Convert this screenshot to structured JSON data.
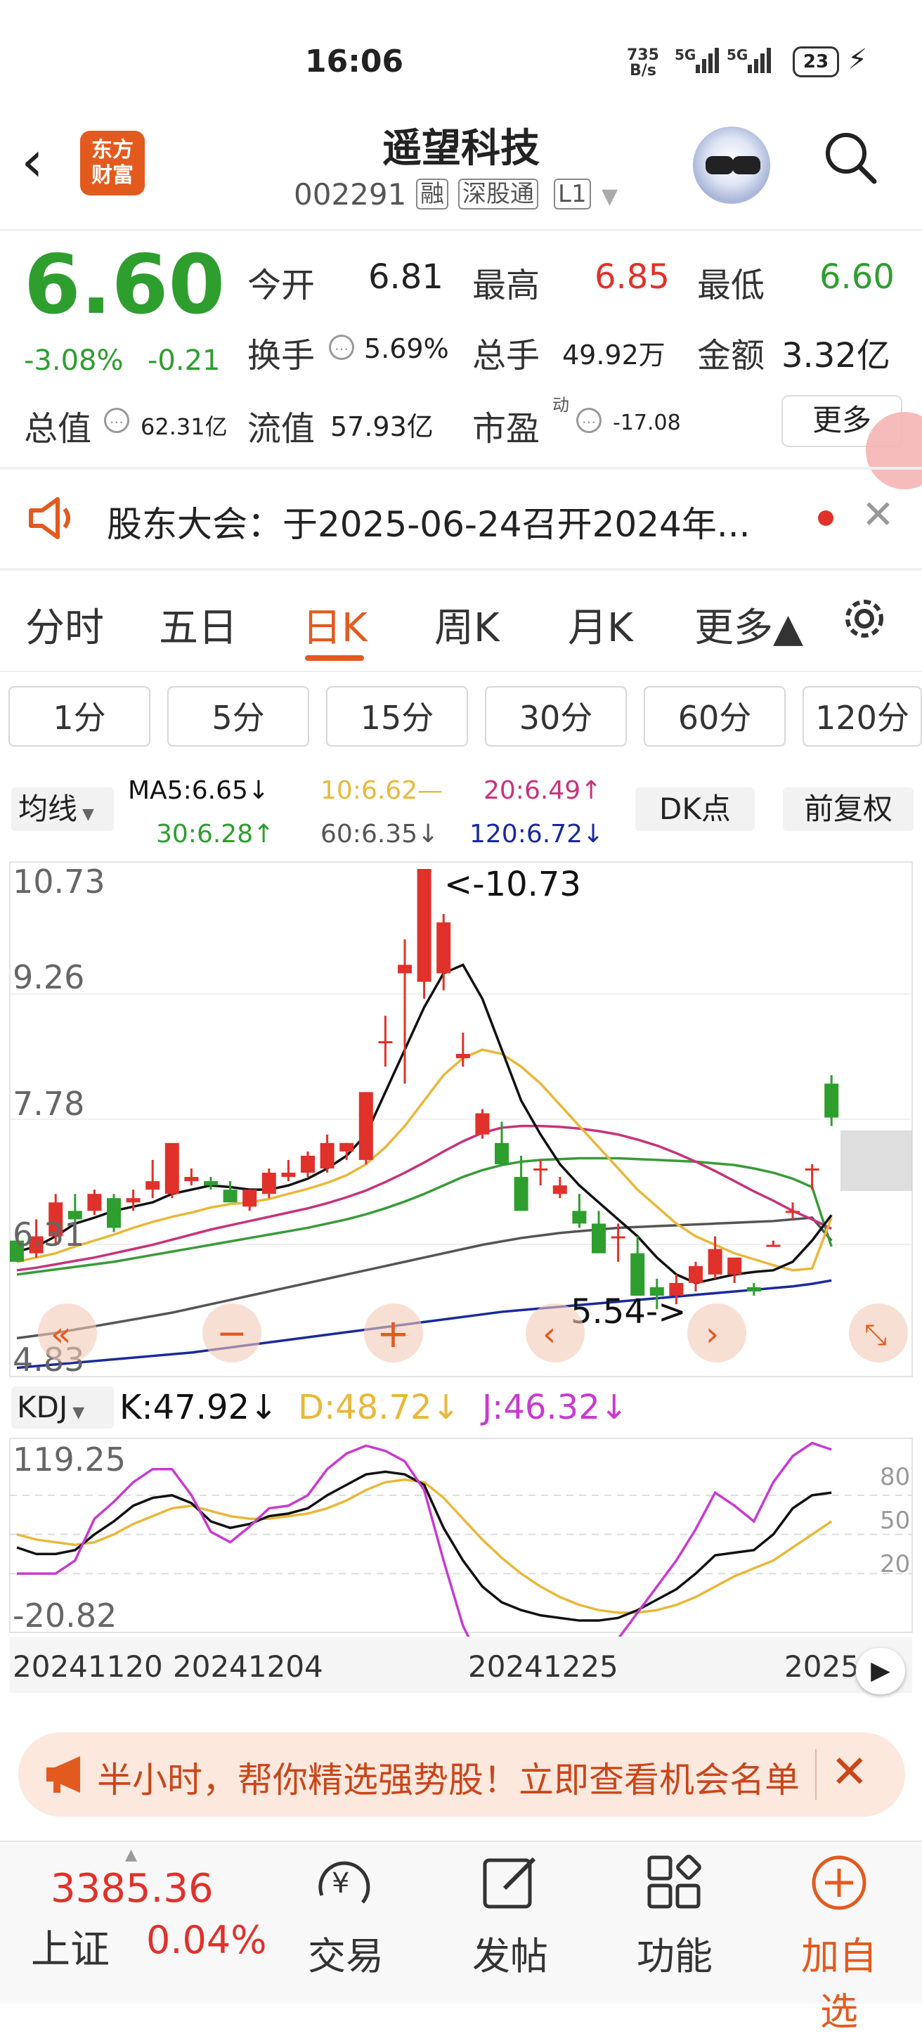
{
  "status_bar": {
    "time": "16:06",
    "net_speed_top": "735",
    "net_speed_bottom": "B/s",
    "sig1": "5G",
    "sig2": "5G",
    "battery": "23"
  },
  "header": {
    "logo_line1": "东方",
    "logo_line2": "财富",
    "stock_name": "遥望科技",
    "stock_code": "002291",
    "tags": [
      "融",
      "深股通",
      "L1"
    ]
  },
  "quote": {
    "price": "6.60",
    "change_pct": "-3.08%",
    "change_val": "-0.21",
    "open_label": "今开",
    "open": "6.81",
    "high_label": "最高",
    "high": "6.85",
    "low_label": "最低",
    "low": "6.60",
    "turnover_label": "换手",
    "turnover": "5.69%",
    "volume_label": "总手",
    "volume": "49.92万",
    "amount_label": "金额",
    "amount": "3.32亿",
    "mktcap_label": "总值",
    "mktcap": "62.31亿",
    "float_label": "流值",
    "float": "57.93亿",
    "pe_label": "市盈",
    "pe_sup": "动",
    "pe": "-17.08",
    "more": "更多"
  },
  "announcement": {
    "text": "股东大会：于2025-06-24召开2024年..."
  },
  "tabs": [
    "分时",
    "五日",
    "日K",
    "周K",
    "月K",
    "更多▲"
  ],
  "periods": [
    "1分",
    "5分",
    "15分",
    "30分",
    "60分",
    "120分"
  ],
  "ma_legend": {
    "selector": "均线",
    "ma5": "MA5:6.65↓",
    "ma10": "10:6.62—",
    "ma20": "20:6.49↑",
    "ma30": "30:6.28↑",
    "ma60": "60:6.35↓",
    "ma120": "120:6.72↓",
    "dk": "DK点",
    "fq": "前复权"
  },
  "colors": {
    "up": "#e0312b",
    "down": "#2e9e2e",
    "ma5": "#111111",
    "ma10": "#e8b83a",
    "ma20": "#c8337a",
    "ma30": "#3a9a3a",
    "ma60": "#555555",
    "ma120": "#1a2a9a",
    "accent": "#e35a1e"
  },
  "kdj": {
    "selector": "KDJ",
    "k": "K:47.92↓",
    "d": "D:48.72↓",
    "j": "J:46.32↓",
    "ytop": "119.25",
    "ybot": "-20.82",
    "ref_levels": [
      "80",
      "50",
      "20"
    ]
  },
  "dates": [
    "20241120",
    "20241204",
    "20241225",
    "2025"
  ],
  "chart_data": {
    "type": "candlestick",
    "y_axis_labels": [
      "10.73",
      "9.26",
      "7.78",
      "6.31",
      "4.83"
    ],
    "ylim": [
      4.83,
      10.73
    ],
    "annotations": [
      "<-10.73",
      "5.54->"
    ],
    "candles": [
      {
        "o": 6.35,
        "h": 6.45,
        "l": 6.1,
        "c": 6.1
      },
      {
        "o": 6.2,
        "h": 6.6,
        "l": 6.15,
        "c": 6.4
      },
      {
        "o": 6.4,
        "h": 6.9,
        "l": 6.3,
        "c": 6.8
      },
      {
        "o": 6.7,
        "h": 6.9,
        "l": 6.55,
        "c": 6.6
      },
      {
        "o": 6.7,
        "h": 6.95,
        "l": 6.65,
        "c": 6.9
      },
      {
        "o": 6.85,
        "h": 6.9,
        "l": 6.45,
        "c": 6.5
      },
      {
        "o": 6.8,
        "h": 6.95,
        "l": 6.7,
        "c": 6.85
      },
      {
        "o": 6.95,
        "h": 7.3,
        "l": 6.85,
        "c": 7.05
      },
      {
        "o": 6.9,
        "h": 7.4,
        "l": 6.85,
        "c": 7.5
      },
      {
        "o": 7.05,
        "h": 7.2,
        "l": 7.0,
        "c": 7.1
      },
      {
        "o": 7.05,
        "h": 7.1,
        "l": 6.95,
        "c": 7.0
      },
      {
        "o": 6.95,
        "h": 7.05,
        "l": 6.8,
        "c": 6.8
      },
      {
        "o": 6.75,
        "h": 6.95,
        "l": 6.7,
        "c": 6.95
      },
      {
        "o": 6.9,
        "h": 7.2,
        "l": 6.85,
        "c": 7.15
      },
      {
        "o": 7.1,
        "h": 7.3,
        "l": 7.05,
        "c": 7.15
      },
      {
        "o": 7.15,
        "h": 7.4,
        "l": 7.1,
        "c": 7.35
      },
      {
        "o": 7.2,
        "h": 7.6,
        "l": 7.15,
        "c": 7.5
      },
      {
        "o": 7.4,
        "h": 7.5,
        "l": 7.3,
        "c": 7.5
      },
      {
        "o": 7.3,
        "h": 8.1,
        "l": 7.25,
        "c": 8.1
      },
      {
        "o": 8.7,
        "h": 9.0,
        "l": 8.4,
        "c": 8.7
      },
      {
        "o": 9.5,
        "h": 9.9,
        "l": 8.2,
        "c": 9.6
      },
      {
        "o": 9.4,
        "h": 10.73,
        "l": 9.2,
        "c": 10.73
      },
      {
        "o": 9.5,
        "h": 10.2,
        "l": 9.3,
        "c": 10.1
      },
      {
        "o": 8.5,
        "h": 8.8,
        "l": 8.4,
        "c": 8.55
      },
      {
        "o": 7.6,
        "h": 7.9,
        "l": 7.55,
        "c": 7.85
      },
      {
        "o": 7.5,
        "h": 7.75,
        "l": 7.25,
        "c": 7.25
      },
      {
        "o": 7.1,
        "h": 7.35,
        "l": 6.75,
        "c": 6.7
      },
      {
        "o": 7.2,
        "h": 7.3,
        "l": 7.0,
        "c": 7.2
      },
      {
        "o": 6.9,
        "h": 7.1,
        "l": 6.85,
        "c": 7.0
      },
      {
        "o": 6.7,
        "h": 6.9,
        "l": 6.5,
        "c": 6.55
      },
      {
        "o": 6.55,
        "h": 6.7,
        "l": 6.3,
        "c": 6.2
      },
      {
        "o": 6.4,
        "h": 6.55,
        "l": 6.1,
        "c": 6.4
      },
      {
        "o": 6.2,
        "h": 6.4,
        "l": 5.7,
        "c": 5.7
      },
      {
        "o": 5.8,
        "h": 5.9,
        "l": 5.54,
        "c": 5.7
      },
      {
        "o": 5.7,
        "h": 5.95,
        "l": 5.6,
        "c": 5.85
      },
      {
        "o": 5.85,
        "h": 6.1,
        "l": 5.75,
        "c": 6.05
      },
      {
        "o": 5.95,
        "h": 6.4,
        "l": 5.9,
        "c": 6.25
      },
      {
        "o": 5.95,
        "h": 6.1,
        "l": 5.85,
        "c": 6.15
      },
      {
        "o": 5.8,
        "h": 5.85,
        "l": 5.7,
        "c": 5.75
      },
      {
        "o": 6.3,
        "h": 6.35,
        "l": 6.3,
        "c": 6.3
      },
      {
        "o": 6.7,
        "h": 6.8,
        "l": 6.6,
        "c": 6.7
      },
      {
        "o": 7.2,
        "h": 7.25,
        "l": 6.95,
        "c": 7.2
      },
      {
        "o": 8.2,
        "h": 8.3,
        "l": 7.7,
        "c": 7.8
      }
    ],
    "ma5": [
      6.22,
      6.28,
      6.4,
      6.55,
      6.62,
      6.7,
      6.75,
      6.8,
      6.9,
      6.95,
      7.0,
      6.98,
      6.95,
      6.95,
      7.0,
      7.08,
      7.2,
      7.35,
      7.6,
      8.1,
      8.6,
      9.1,
      9.5,
      9.6,
      9.2,
      8.6,
      8.0,
      7.6,
      7.25,
      7.0,
      6.8,
      6.6,
      6.4,
      6.15,
      5.95,
      5.85,
      5.9,
      5.95,
      5.98,
      6.0,
      6.1,
      6.35,
      6.65
    ],
    "ma10": [
      6.1,
      6.15,
      6.2,
      6.28,
      6.35,
      6.42,
      6.5,
      6.57,
      6.63,
      6.68,
      6.74,
      6.78,
      6.8,
      6.84,
      6.9,
      6.96,
      7.03,
      7.12,
      7.25,
      7.45,
      7.7,
      8.0,
      8.3,
      8.5,
      8.6,
      8.55,
      8.4,
      8.2,
      7.95,
      7.7,
      7.45,
      7.2,
      6.95,
      6.75,
      6.55,
      6.4,
      6.3,
      6.2,
      6.13,
      6.06,
      6.0,
      6.02,
      6.62
    ],
    "ma20": [
      6.0,
      6.03,
      6.07,
      6.11,
      6.15,
      6.2,
      6.25,
      6.3,
      6.36,
      6.42,
      6.48,
      6.53,
      6.58,
      6.63,
      6.68,
      6.73,
      6.79,
      6.86,
      6.94,
      7.04,
      7.15,
      7.27,
      7.4,
      7.52,
      7.62,
      7.68,
      7.7,
      7.7,
      7.69,
      7.67,
      7.64,
      7.6,
      7.54,
      7.47,
      7.38,
      7.28,
      7.17,
      7.05,
      6.93,
      6.82,
      6.7,
      6.6,
      6.49
    ],
    "ma30": [
      5.95,
      5.98,
      6.01,
      6.04,
      6.07,
      6.1,
      6.14,
      6.18,
      6.22,
      6.26,
      6.3,
      6.34,
      6.38,
      6.42,
      6.46,
      6.5,
      6.55,
      6.6,
      6.66,
      6.73,
      6.81,
      6.9,
      7.0,
      7.1,
      7.18,
      7.24,
      7.28,
      7.3,
      7.31,
      7.32,
      7.32,
      7.32,
      7.31,
      7.3,
      7.29,
      7.28,
      7.26,
      7.24,
      7.2,
      7.15,
      7.08,
      6.98,
      6.28
    ],
    "ma60": [
      5.2,
      5.23,
      5.26,
      5.3,
      5.34,
      5.38,
      5.42,
      5.46,
      5.5,
      5.55,
      5.6,
      5.65,
      5.7,
      5.75,
      5.8,
      5.85,
      5.9,
      5.95,
      6.0,
      6.05,
      6.1,
      6.15,
      6.2,
      6.25,
      6.3,
      6.34,
      6.38,
      6.41,
      6.44,
      6.46,
      6.48,
      6.5,
      6.51,
      6.52,
      6.53,
      6.54,
      6.55,
      6.56,
      6.57,
      6.58,
      6.6,
      6.62,
      6.35
    ],
    "ma120": [
      4.85,
      4.87,
      4.89,
      4.91,
      4.93,
      4.95,
      4.97,
      4.99,
      5.01,
      5.03,
      5.06,
      5.09,
      5.12,
      5.15,
      5.18,
      5.21,
      5.24,
      5.27,
      5.3,
      5.33,
      5.36,
      5.39,
      5.42,
      5.45,
      5.48,
      5.51,
      5.53,
      5.55,
      5.57,
      5.59,
      5.61,
      5.63,
      5.65,
      5.67,
      5.69,
      5.71,
      5.73,
      5.75,
      5.77,
      5.79,
      5.81,
      5.84,
      5.88
    ],
    "kdj_k": [
      40,
      35,
      35,
      38,
      50,
      60,
      72,
      78,
      80,
      74,
      60,
      55,
      58,
      64,
      66,
      70,
      80,
      88,
      96,
      98,
      96,
      88,
      55,
      30,
      10,
      -2,
      -8,
      -12,
      -14,
      -16,
      -16,
      -14,
      -8,
      0,
      8,
      20,
      34,
      36,
      38,
      50,
      70,
      80,
      82
    ],
    "kdj_d": [
      50,
      46,
      44,
      42,
      44,
      50,
      58,
      64,
      70,
      72,
      68,
      64,
      62,
      62,
      64,
      66,
      70,
      76,
      84,
      90,
      92,
      90,
      78,
      62,
      46,
      32,
      20,
      10,
      2,
      -4,
      -8,
      -10,
      -10,
      -8,
      -4,
      2,
      10,
      18,
      24,
      30,
      40,
      50,
      60
    ],
    "kdj_j": [
      20,
      20,
      20,
      30,
      62,
      75,
      90,
      100,
      100,
      80,
      52,
      44,
      56,
      70,
      72,
      80,
      100,
      112,
      118,
      114,
      106,
      84,
      30,
      -20,
      -50,
      -60,
      -62,
      -60,
      -58,
      -52,
      -46,
      -30,
      -10,
      10,
      30,
      54,
      82,
      72,
      60,
      90,
      110,
      120,
      115
    ]
  },
  "promo": {
    "text": "半小时，帮你精选强势股！立即查看机会名单"
  },
  "bottom_nav": {
    "index_value": "3385.36",
    "index_name": "上证",
    "index_pct": "0.04%",
    "items": [
      "交易",
      "发帖",
      "功能",
      "加自选"
    ]
  }
}
